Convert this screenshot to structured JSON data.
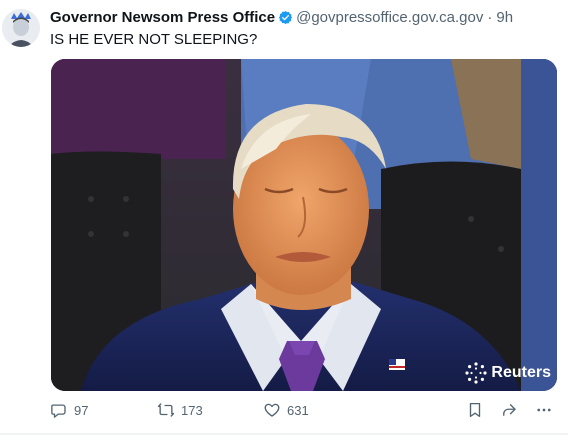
{
  "tweet": {
    "author_name": "Governor Newsom Press Office",
    "handle": "@govpressoffice.gov.ca.gov",
    "separator": "·",
    "timestamp": "9h",
    "text": "IS HE EVER NOT SLEEPING?",
    "verified_icon": "verified-badge-icon",
    "verified_color": "#1d9bf0"
  },
  "media": {
    "watermark": "Reuters",
    "watermark_icon": "reuters-logo-icon"
  },
  "actions": {
    "replies": "97",
    "reposts": "173",
    "likes": "631",
    "reply_icon": "reply-icon",
    "repost_icon": "repost-icon",
    "like_icon": "heart-icon",
    "bookmark_icon": "bookmark-icon",
    "share_icon": "share-icon",
    "more_icon": "more-icon"
  },
  "colors": {
    "text_primary": "#0f1419",
    "text_secondary": "#536471",
    "accent": "#1d9bf0"
  }
}
